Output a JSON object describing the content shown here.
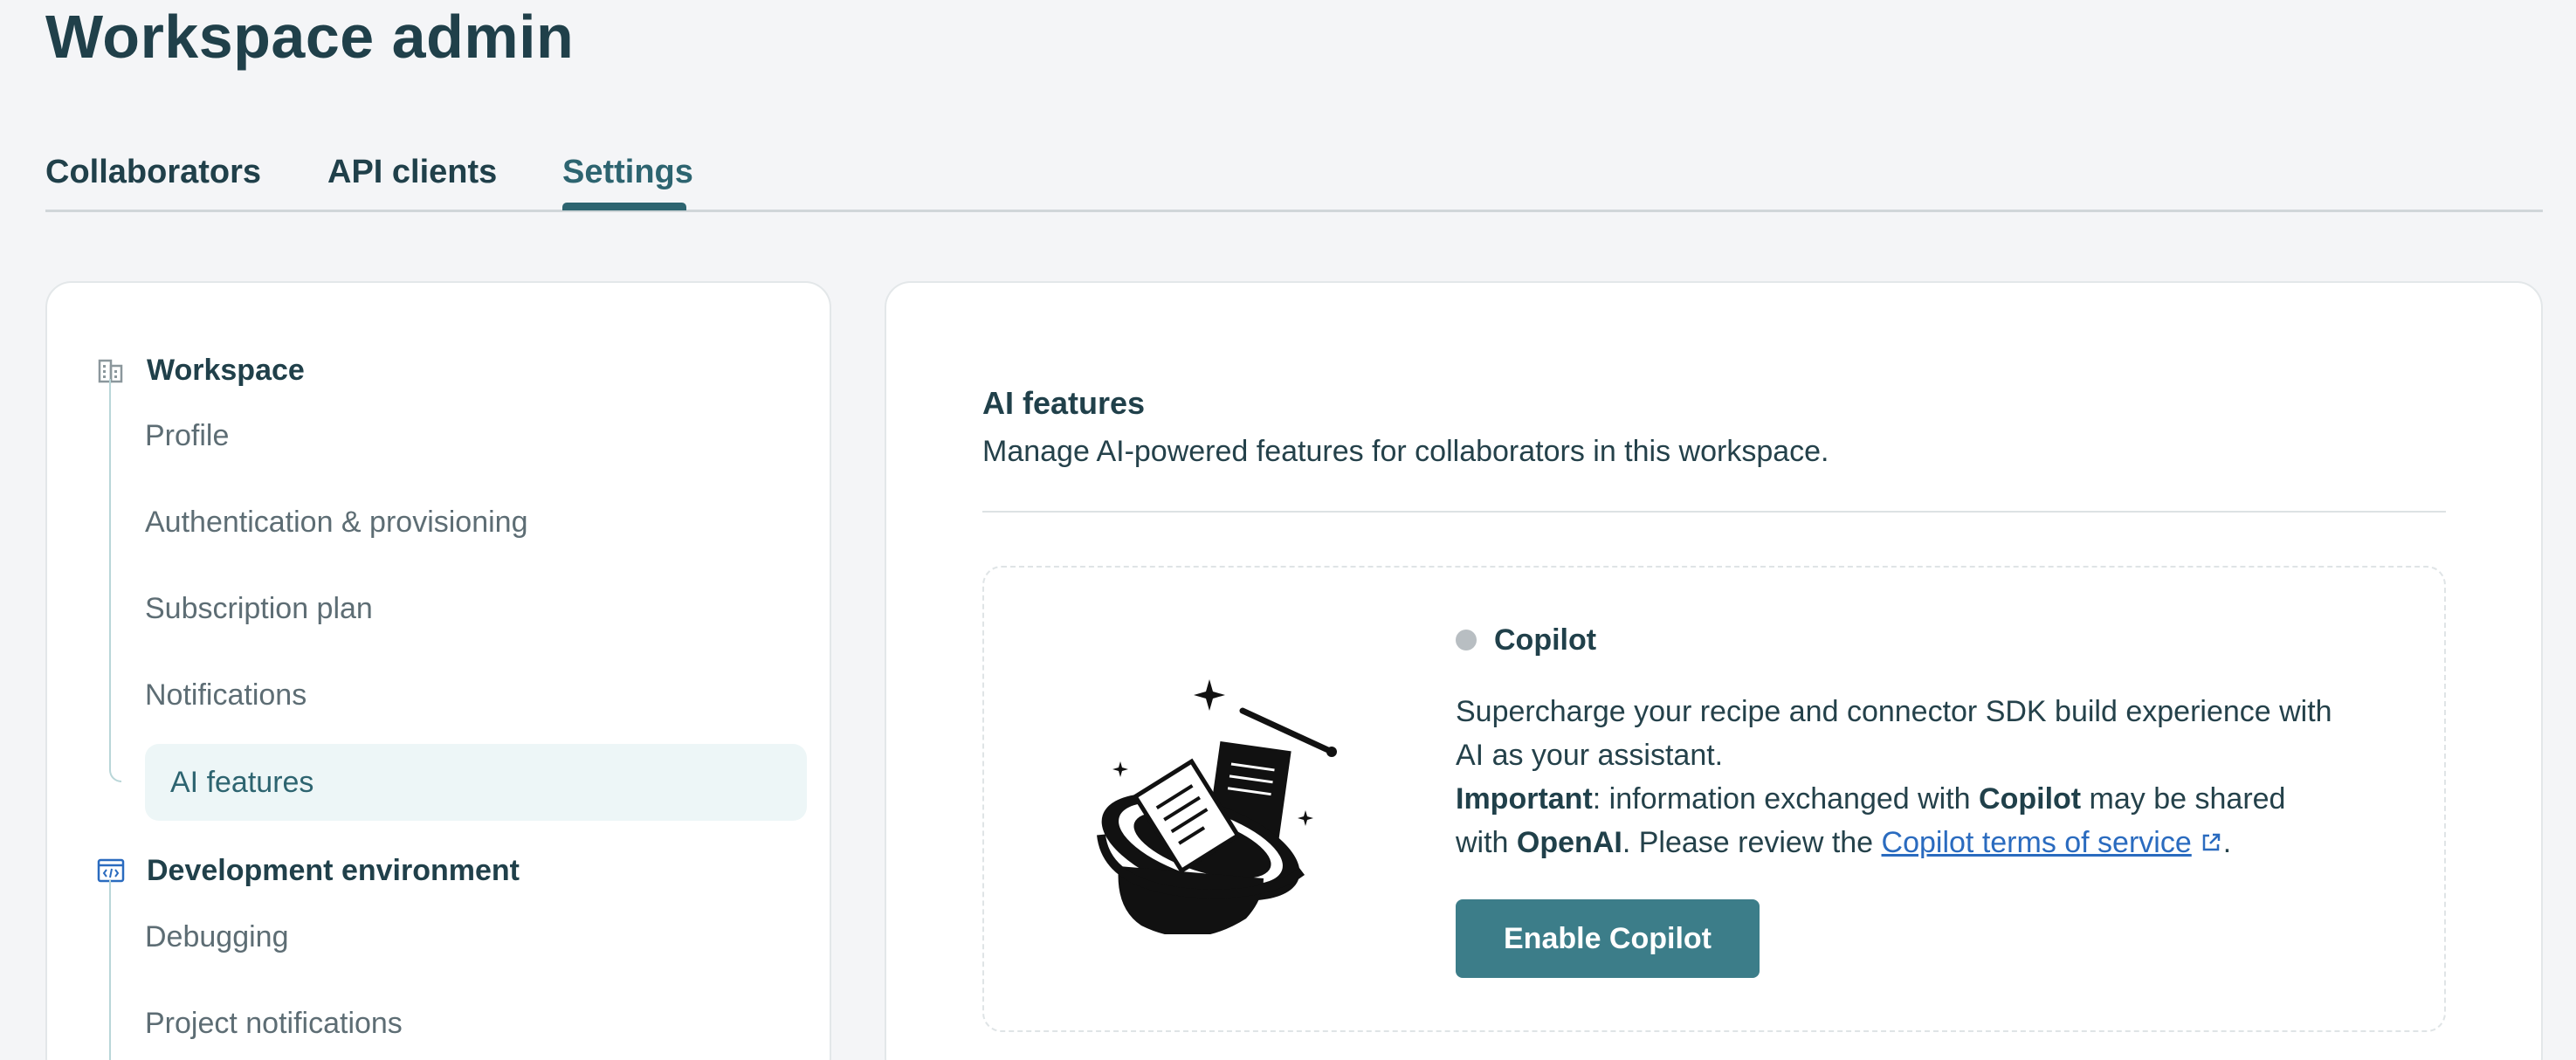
{
  "page_title": "Workspace admin",
  "tabs": [
    {
      "label": "Collaborators"
    },
    {
      "label": "API clients"
    },
    {
      "label": "Settings",
      "active": true
    }
  ],
  "sidebar": {
    "sections": [
      {
        "label": "Workspace",
        "icon": "building-icon",
        "items": [
          {
            "label": "Profile"
          },
          {
            "label": "Authentication & provisioning"
          },
          {
            "label": "Subscription plan"
          },
          {
            "label": "Notifications"
          },
          {
            "label": "AI features",
            "active": true
          }
        ]
      },
      {
        "label": "Development environment",
        "icon": "code-window-icon",
        "items": [
          {
            "label": "Debugging"
          },
          {
            "label": "Project notifications"
          }
        ]
      }
    ]
  },
  "main": {
    "title": "AI features",
    "description": "Manage AI-powered features for collaborators in this workspace.",
    "feature": {
      "name": "Copilot",
      "status_color": "#b8bec2",
      "body_line1": "Supercharge your recipe and connector SDK build experience with AI as your assistant.",
      "important_label": "Important",
      "important_text1": ": information exchanged with ",
      "copilot_bold": "Copilot",
      "important_text2": " may be shared with ",
      "openai_bold": "OpenAI",
      "important_text3": ". Please review the ",
      "terms_link": "Copilot terms of service",
      "important_end": ".",
      "illustration_icon": "magic-hat-icon",
      "button_label": "Enable Copilot"
    }
  },
  "colors": {
    "accent": "#2d6470",
    "button": "#3c7d89",
    "link": "#2a6bbf",
    "active_item_bg": "#edf6f7"
  }
}
